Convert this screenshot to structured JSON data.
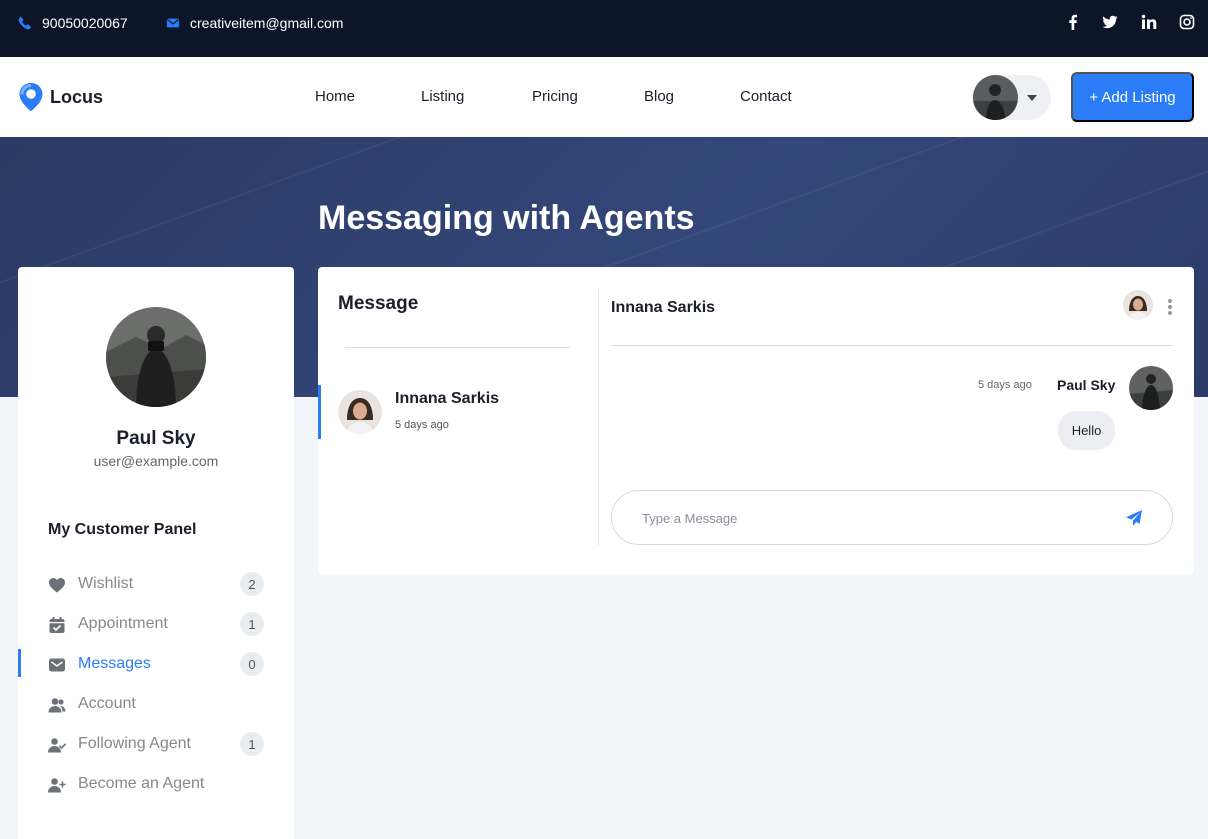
{
  "topbar": {
    "phone": "90050020067",
    "email": "creativeitem@gmail.com",
    "socials": [
      "facebook-icon",
      "twitter-icon",
      "linkedin-icon",
      "instagram-icon"
    ]
  },
  "nav": {
    "logo": "Locus",
    "links": [
      "Home",
      "Listing",
      "Pricing",
      "Blog",
      "Contact"
    ],
    "add_listing": "+ Add Listing"
  },
  "hero": {
    "title": "Messaging with Agents"
  },
  "sidebar": {
    "name": "Paul Sky",
    "email": "user@example.com",
    "panel_title": "My Customer Panel",
    "items": [
      {
        "label": "Wishlist",
        "icon": "heart-icon",
        "badge": "2"
      },
      {
        "label": "Appointment",
        "icon": "calendar-icon",
        "badge": "1"
      },
      {
        "label": "Messages",
        "icon": "envelope-icon",
        "badge": "0",
        "active": true
      },
      {
        "label": "Account",
        "icon": "users-icon"
      },
      {
        "label": "Following Agent",
        "icon": "user-check-icon",
        "badge": "1"
      },
      {
        "label": "Become an Agent",
        "icon": "user-plus-icon"
      }
    ]
  },
  "messages": {
    "title": "Message",
    "conversation": {
      "name": "Innana Sarkis",
      "time": "5 days ago"
    },
    "chat": {
      "name": "Innana Sarkis",
      "message": {
        "time": "5 days ago",
        "sender": "Paul Sky",
        "text": "Hello"
      },
      "placeholder": "Type a Message"
    }
  },
  "colors": {
    "primary": "#2a7cf7",
    "topbar": "#0d1629",
    "hero": "#2f4272"
  }
}
